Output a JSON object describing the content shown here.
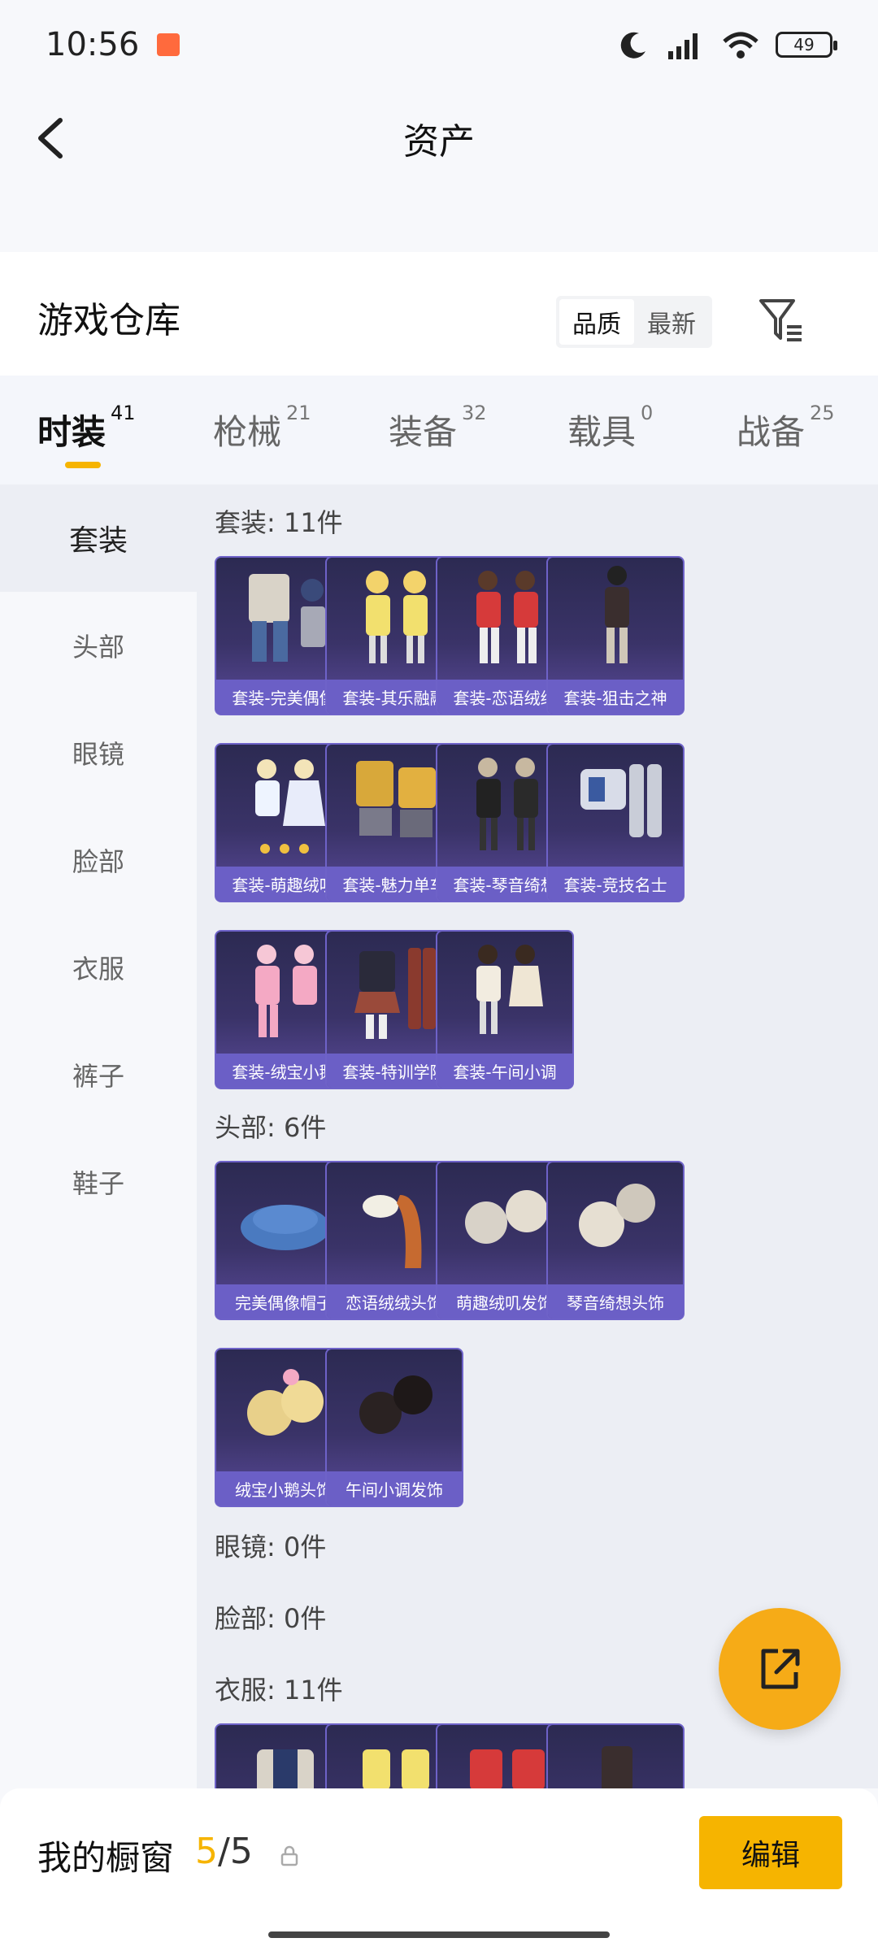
{
  "status_bar": {
    "time": "10:56",
    "battery": "49"
  },
  "header": {
    "title": "资产"
  },
  "warehouse": {
    "title": "游戏仓库",
    "sort_options": [
      "品质",
      "最新"
    ],
    "active_sort": "品质"
  },
  "tabs": [
    {
      "label": "时装",
      "count": "41",
      "active": true
    },
    {
      "label": "枪械",
      "count": "21"
    },
    {
      "label": "装备",
      "count": "32"
    },
    {
      "label": "载具",
      "count": "0"
    },
    {
      "label": "战备",
      "count": "25"
    }
  ],
  "left_menu": [
    {
      "label": "套装",
      "active": true
    },
    {
      "label": "头部"
    },
    {
      "label": "眼镜"
    },
    {
      "label": "脸部"
    },
    {
      "label": "衣服"
    },
    {
      "label": "裤子"
    },
    {
      "label": "鞋子"
    }
  ],
  "sections": {
    "suit": {
      "label": "套装: 11件",
      "items": [
        "套装-完美偶像",
        "套装-其乐融融",
        "套装-恋语绒绒",
        "套装-狙击之神",
        "套装-萌趣绒叽",
        "套装-魅力单车",
        "套装-琴音绮想",
        "套装-竞技名士",
        "套装-绒宝小鹅",
        "套装-特训学院",
        "套装-午间小调"
      ]
    },
    "head": {
      "label": "头部: 6件",
      "items": [
        "完美偶像帽子",
        "恋语绒绒头饰",
        "萌趣绒叽发饰",
        "琴音绮想头饰",
        "绒宝小鹅头饰",
        "午间小调发饰"
      ]
    },
    "glasses": {
      "label": "眼镜: 0件"
    },
    "face": {
      "label": "脸部: 0件"
    },
    "clothes": {
      "label": "衣服: 11件"
    }
  },
  "bottom": {
    "title": "我的橱窗",
    "count_current": "5",
    "count_total": "/5",
    "edit_label": "编辑"
  },
  "colors": {
    "accent": "#f6b400",
    "card_bg": "#3a3368",
    "card_caption": "#6b5fc6"
  }
}
